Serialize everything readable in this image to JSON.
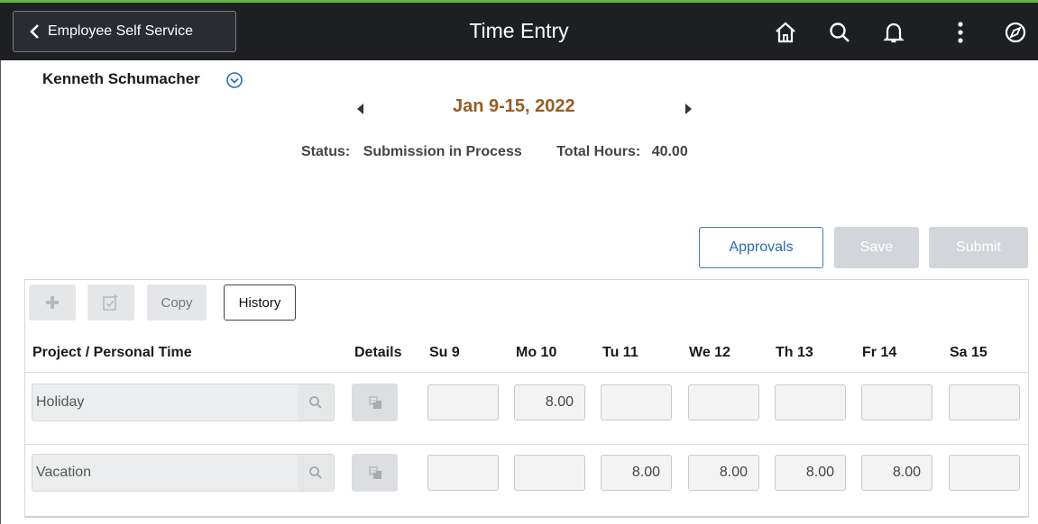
{
  "header": {
    "back_label": "Employee Self Service",
    "title": "Time Entry",
    "icons": [
      "home-icon",
      "search-icon",
      "bell-icon",
      "more-vertical-icon",
      "compass-icon"
    ]
  },
  "employee": {
    "name": "Kenneth Schumacher"
  },
  "period": {
    "label": "Jan 9-15, 2022"
  },
  "summary": {
    "status_label": "Status:",
    "status_value": "Submission in Process",
    "hours_label": "Total Hours:",
    "hours_value": "40.00"
  },
  "actions": {
    "approvals": "Approvals",
    "save": "Save",
    "submit": "Submit"
  },
  "toolbar": {
    "copy": "Copy",
    "history": "History"
  },
  "columns": {
    "project": "Project / Personal Time",
    "details": "Details",
    "days": [
      "Su 9",
      "Mo 10",
      "Tu 11",
      "We 12",
      "Th 13",
      "Fr 14",
      "Sa 15"
    ]
  },
  "rows": [
    {
      "project": "Holiday",
      "hours": [
        "",
        "8.00",
        "",
        "",
        "",
        "",
        ""
      ]
    },
    {
      "project": "Vacation",
      "hours": [
        "",
        "",
        "8.00",
        "8.00",
        "8.00",
        "8.00",
        ""
      ]
    }
  ],
  "colors": {
    "accent": "#64b33f",
    "header_bg": "#1d1f23",
    "period": "#9a5b23",
    "link": "#2a6bb0"
  }
}
